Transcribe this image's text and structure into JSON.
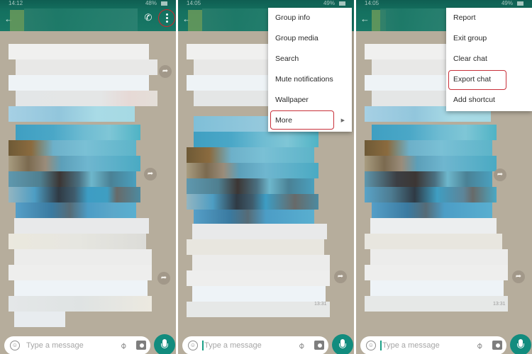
{
  "panels": [
    {
      "status": {
        "time": "14:12",
        "battery": "48%"
      },
      "toolbar": {
        "back": "←",
        "add_call": "✆+"
      },
      "composer": {
        "placeholder": "Type a message"
      },
      "timestamp": "",
      "highlight": "overflow-menu-button"
    },
    {
      "status": {
        "time": "14:05",
        "battery": "49%"
      },
      "toolbar": {
        "back": "←"
      },
      "menu": {
        "items": [
          {
            "label": "Group info"
          },
          {
            "label": "Group media"
          },
          {
            "label": "Search"
          },
          {
            "label": "Mute notifications"
          },
          {
            "label": "Wallpaper"
          },
          {
            "label": "More",
            "submenu_arrow": "▶"
          }
        ],
        "highlighted": "More"
      },
      "composer": {
        "placeholder": "Type a message"
      },
      "timestamp": "13:31"
    },
    {
      "status": {
        "time": "14:05",
        "battery": "49%"
      },
      "toolbar": {
        "back": "←"
      },
      "menu": {
        "items": [
          {
            "label": "Report"
          },
          {
            "label": "Exit group"
          },
          {
            "label": "Clear chat"
          },
          {
            "label": "Export chat"
          },
          {
            "label": "Add shortcut"
          }
        ],
        "highlighted": "Export chat"
      },
      "composer": {
        "placeholder": "Type a message"
      },
      "timestamp": "13:31"
    }
  ],
  "icons": {
    "emoji": "☺",
    "attach": "📎",
    "forward": "➦"
  },
  "colors": {
    "toolbar": "#187866",
    "mic_button": "#128c7e",
    "highlight": "#d2252b",
    "chat_background": "#b6ad9c"
  }
}
